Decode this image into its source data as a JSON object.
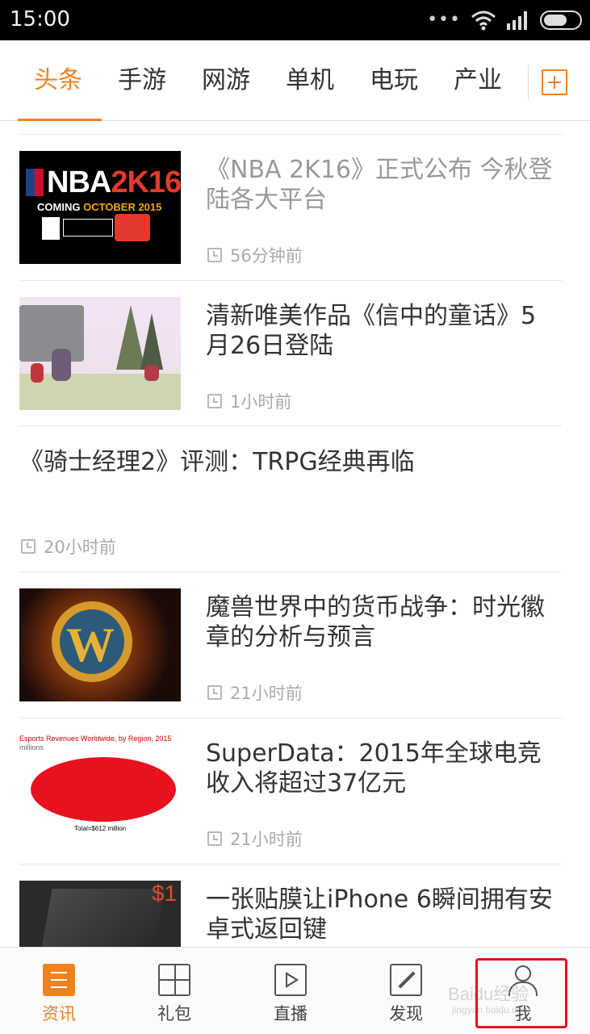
{
  "status_bar": {
    "time": "15:00",
    "more_icon": "dots-icon",
    "wifi_icon": "wifi-icon",
    "signal_icon": "signal-icon",
    "battery_icon": "battery-icon"
  },
  "tabs": {
    "items": [
      {
        "label": "头条",
        "active": true
      },
      {
        "label": "手游"
      },
      {
        "label": "网游"
      },
      {
        "label": "单机"
      },
      {
        "label": "电玩"
      },
      {
        "label": "产业"
      }
    ],
    "add_icon": "plus-square-icon"
  },
  "accent_color": "#f0821e",
  "feed": [
    {
      "title": "《NBA 2K16》正式公布 今秋登陆各大平台",
      "time": "56分钟前",
      "read": true,
      "thumb": "nba-2k16",
      "thumb_text": {
        "nba": "NBA",
        "twok": "2K16",
        "coming": "COMING",
        "month": "OCTOBER 2015"
      }
    },
    {
      "title": "清新唯美作品《信中的童话》5月26日登陆",
      "time": "1小时前",
      "read": false,
      "thumb": "fairy-game"
    },
    {
      "title": "《骑士经理2》评测：TRPG经典再临",
      "time": "20小时前",
      "read": false,
      "thumb": null
    },
    {
      "title": "魔兽世界中的货币战争：时光徽章的分析与预言",
      "time": "21小时前",
      "read": false,
      "thumb": "wow-badge"
    },
    {
      "title": "SuperData：2015年全球电竞收入将超过37亿元",
      "time": "21小时前",
      "read": false,
      "thumb": "esports-pie",
      "thumb_text": {
        "head": "Esports Revenues Worldwide, by Region, 2015",
        "unit": "millions",
        "total": "Total=$612 million"
      }
    },
    {
      "title": "一张贴膜让iPhone 6瞬间拥有安卓式返回键",
      "time": "",
      "read": false,
      "thumb": "screen-protector",
      "thumb_text": {
        "price": "$1"
      }
    }
  ],
  "bottom_nav": [
    {
      "label": "资讯",
      "icon": "news-icon",
      "active": true
    },
    {
      "label": "礼包",
      "icon": "gift-icon"
    },
    {
      "label": "直播",
      "icon": "play-icon"
    },
    {
      "label": "发现",
      "icon": "compass-icon"
    },
    {
      "label": "我",
      "icon": "profile-icon"
    }
  ],
  "watermark": {
    "line1": "Baidu经验",
    "line2": "jingyan.baidu.com"
  }
}
